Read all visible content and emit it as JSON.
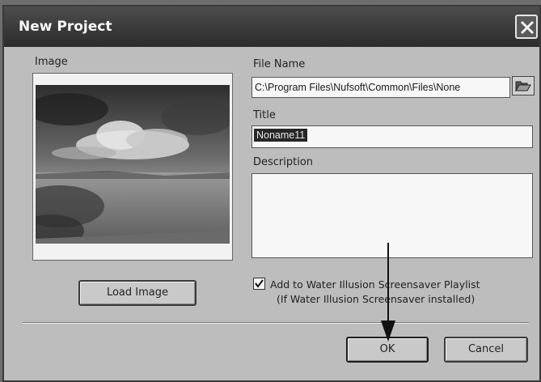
{
  "window": {
    "title": "New Project"
  },
  "image_panel": {
    "label": "Image"
  },
  "buttons": {
    "load_image": "Load Image",
    "ok": "OK",
    "cancel": "Cancel"
  },
  "fields": {
    "file_name_label": "File Name",
    "file_name_value": "C:\\Program Files\\Nufsoft\\Common\\Files\\None",
    "title_label": "Title",
    "title_value": "Noname11",
    "description_label": "Description",
    "description_value": ""
  },
  "playlist": {
    "checked": true,
    "label_line1": "Add to Water Illusion Screensaver Playlist",
    "label_line2": "(If Water Illusion Screensaver installed)"
  },
  "icons": {
    "close": "close-icon",
    "browse": "folder-open-icon",
    "check": "check-icon",
    "annotation": "arrow-down-icon"
  }
}
